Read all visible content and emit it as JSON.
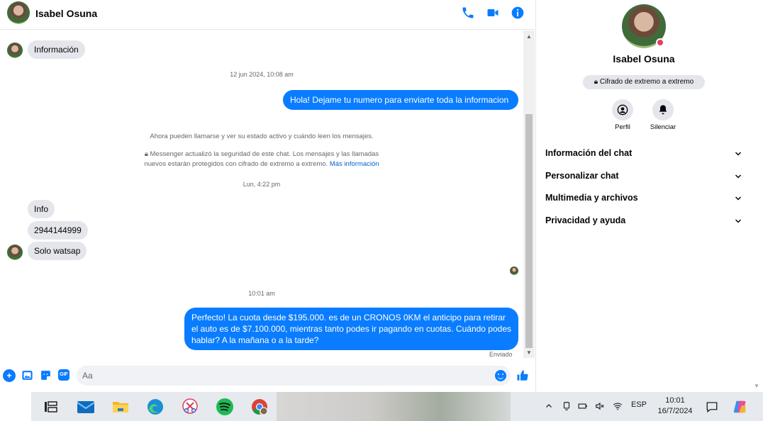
{
  "header": {
    "contact_name": "Isabel Osuna",
    "icons": [
      "phone-icon",
      "video-icon",
      "info-icon"
    ]
  },
  "messages": {
    "received_1": "Información",
    "timestamp_1": "12 jun 2024, 10:08 am",
    "sent_1": "Hola! Dejame tu numero  para enviarte toda la informacion",
    "system_1": "Ahora pueden llamarse y ver su estado activo y cuándo leen los mensajes.",
    "system_2_line1": "Messenger actualizó la seguridad de este chat. Los mensajes y las llamadas",
    "system_2_line2": "nuevos estarán protegidos con cifrado de extremo a extremo.",
    "system_2_link": "Más información",
    "timestamp_2": "Lun, 4:22 pm",
    "received_2": "Info",
    "received_3": "2944144999",
    "received_4": "Solo watsap",
    "timestamp_3": "10:01 am",
    "sent_2": "Perfecto! La cuota desde $195.000. es de un CRONOS 0KM el anticipo para retirar el auto es de $7.100.000, mientras tanto podes ir pagando en cuotas. Cuándo podes hablar? A la mañana o a la tarde?",
    "sent_status": "Enviado"
  },
  "composer": {
    "placeholder": "Aa",
    "gif_label": "GIF",
    "plus_label": "+"
  },
  "panel": {
    "name": "Isabel Osuna",
    "encryption_badge": "Cifrado de extremo a extremo",
    "profile_label": "Perfil",
    "mute_label": "Silenciar",
    "sections": [
      {
        "label": "Información del chat"
      },
      {
        "label": "Personalizar chat"
      },
      {
        "label": "Multimedia y archivos"
      },
      {
        "label": "Privacidad y ayuda"
      }
    ]
  },
  "taskbar": {
    "apps": [
      "task-view-icon",
      "mail-icon",
      "file-explorer-icon",
      "edge-icon",
      "snipping-tool-icon",
      "spotify-icon",
      "chrome-icon"
    ],
    "lang": "ESP",
    "time": "10:01",
    "date": "16/7/2024"
  },
  "colors": {
    "messenger_blue": "#0a7cff",
    "bubble_gray": "#e4e6eb"
  }
}
